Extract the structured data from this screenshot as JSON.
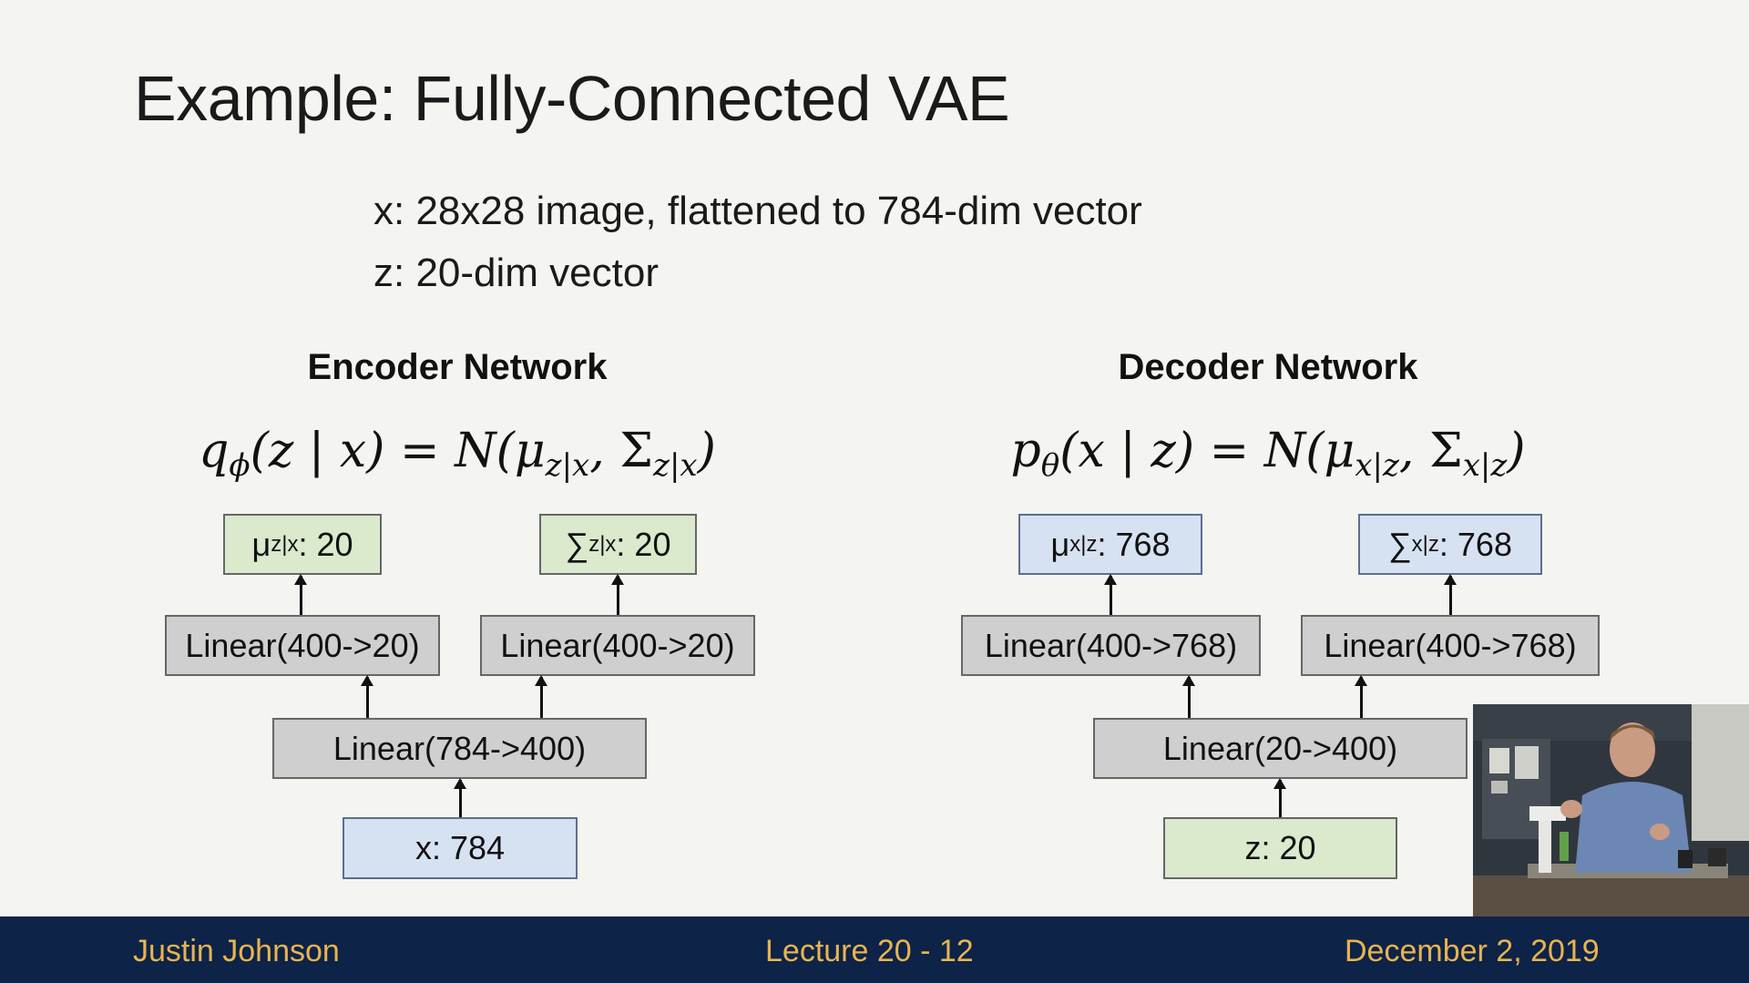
{
  "slide": {
    "title": "Example: Fully-Connected VAE",
    "desc_x": "x: 28x28 image, flattened to 784-dim vector",
    "desc_z": "z: 20-dim vector"
  },
  "encoder": {
    "title": "Encoder Network",
    "eq": {
      "q": "q",
      "phi": "ϕ",
      "args": "(z | x) = N(μ",
      "sub1": "z|x",
      "comma": ", ",
      "sigma": "Σ",
      "sub2": "z|x",
      "close": ")"
    },
    "mu_box": {
      "sym": "μ",
      "sub": "z|x",
      "val": ": 20"
    },
    "sigma_box": {
      "sym": "∑",
      "sub": "z|x",
      "val": ": 20"
    },
    "linear_mu": "Linear(400->20)",
    "linear_sigma": "Linear(400->20)",
    "linear_hidden": "Linear(784->400)",
    "input": "x: 784"
  },
  "decoder": {
    "title": "Decoder Network",
    "eq": {
      "p": "p",
      "theta": "θ",
      "args": "(x | z) = N(μ",
      "sub1": "x|z",
      "comma": ", ",
      "sigma": "Σ",
      "sub2": "x|z",
      "close": ")"
    },
    "mu_box": {
      "sym": "μ",
      "sub": "x|z",
      "val": ": 768"
    },
    "sigma_box": {
      "sym": "∑",
      "sub": "x|z",
      "val": ": 768"
    },
    "linear_mu": "Linear(400->768)",
    "linear_sigma": "Linear(400->768)",
    "linear_hidden": "Linear(20->400)",
    "input": "z: 20"
  },
  "footer": {
    "author": "Justin Johnson",
    "lecture": "Lecture 20 - 12",
    "date": "December 2, 2019"
  },
  "colors": {
    "footer_bg": "#0d2347",
    "footer_text": "#e8b451",
    "box_gray": "#cfcfcf",
    "box_green": "#dbe9cc",
    "box_blue": "#d6e2f1"
  }
}
